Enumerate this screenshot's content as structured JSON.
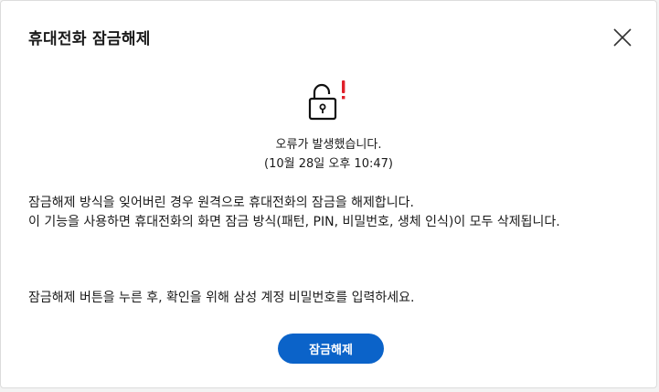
{
  "dialog": {
    "title": "휴대전화 잠금해제",
    "close_icon": "close-icon",
    "status_icon": "unlock-error-icon",
    "status": {
      "message": "오류가 발생했습니다.",
      "timestamp": "(10월 28일 오후 10:47)"
    },
    "description": {
      "line1": "잠금해제 방식을 잊어버린 경우 원격으로 휴대전화의 잠금을 해제합니다.",
      "line2": "이 기능을 사용하면 휴대전화의 화면 잠금 방식(패턴, PIN, 비밀번호, 생체 인식)이 모두 삭제됩니다.",
      "instruction": "잠금해제 버튼을 누른 후, 확인을 위해 삼성 계정 비밀번호를 입력하세요."
    },
    "unlock_button_label": "잠금해제",
    "colors": {
      "accent": "#0b63c9",
      "error": "#e0202a"
    }
  }
}
